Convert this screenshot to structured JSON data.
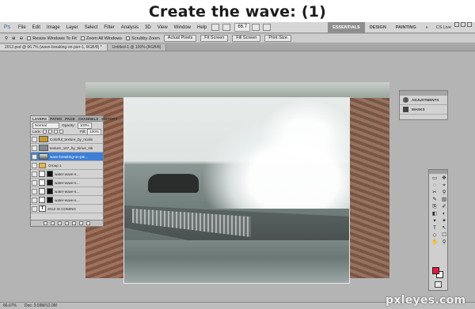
{
  "heading": "Create the wave: (1)",
  "menubar": {
    "logo": "Ps",
    "items": [
      "File",
      "Edit",
      "Image",
      "Layer",
      "Select",
      "Filter",
      "Analysis",
      "3D",
      "View",
      "Window",
      "Help"
    ],
    "zoom": "66.7",
    "workspaces": [
      "ESSENTIALS",
      "DESIGN",
      "PAINTING",
      "»"
    ],
    "cs_live": "CS Live"
  },
  "options_bar": {
    "resize_windows": "Resize Windows To Fit",
    "zoom_all": "Zoom All Windows",
    "scrubby_zoom": "Scrubby Zoom",
    "actual_pixels": "Actual Pixels",
    "fit_screen": "Fit Screen",
    "fill_screen": "Fill Screen",
    "print_size": "Print Size"
  },
  "doc_tabs": [
    "2012.psd @ 66.7% (wave-breaking-on-pier-1, RGB/8) *",
    "Untitled-1 @ 100% (RGB/8)"
  ],
  "layers_panel": {
    "tabs": [
      "LAYERS",
      "PATHS",
      "PAGE",
      "CHANNELS",
      "HISTORY"
    ],
    "blend_mode": "Normal",
    "opacity_label": "Opacity:",
    "opacity_value": "100%",
    "lock_label": "Lock:",
    "fill_label": "Fill:",
    "fill_value": "100%",
    "layers": [
      {
        "name": "Colorful_texture_by_ncalio",
        "selected": false
      },
      {
        "name": "texture_107_by_Sirius_stk",
        "selected": false
      },
      {
        "name": "wave-breaking-on-pie...",
        "selected": true
      },
      {
        "name": "Group 1",
        "selected": false
      },
      {
        "name": "water-wave-s...",
        "selected": false
      },
      {
        "name": "water-wave-s...",
        "selected": false
      },
      {
        "name": "water-wave-s...",
        "selected": false
      },
      {
        "name": "water-wave-s...",
        "selected": false
      },
      {
        "name": "2012 IS COMING",
        "selected": false
      }
    ]
  },
  "adjustments_panel": {
    "items": [
      "ADJUSTMENTS",
      "MASKS"
    ]
  },
  "tools": [
    "▭",
    "✥",
    "◌",
    "⌖",
    "✂",
    "⚲",
    "✎",
    "▥",
    "⎘",
    "✐",
    "◧",
    "◐",
    "▾",
    "✦",
    "T",
    "↖",
    "◇",
    "☐",
    "✋",
    "⚲"
  ],
  "colors": {
    "foreground": "#e8153c",
    "background": "#ffffff",
    "selected_layer": "#3d7fd6"
  },
  "status": {
    "zoom": "66.67%",
    "doc": "Doc: 3.59M/12.0M"
  },
  "watermark": "pxleyes.com"
}
